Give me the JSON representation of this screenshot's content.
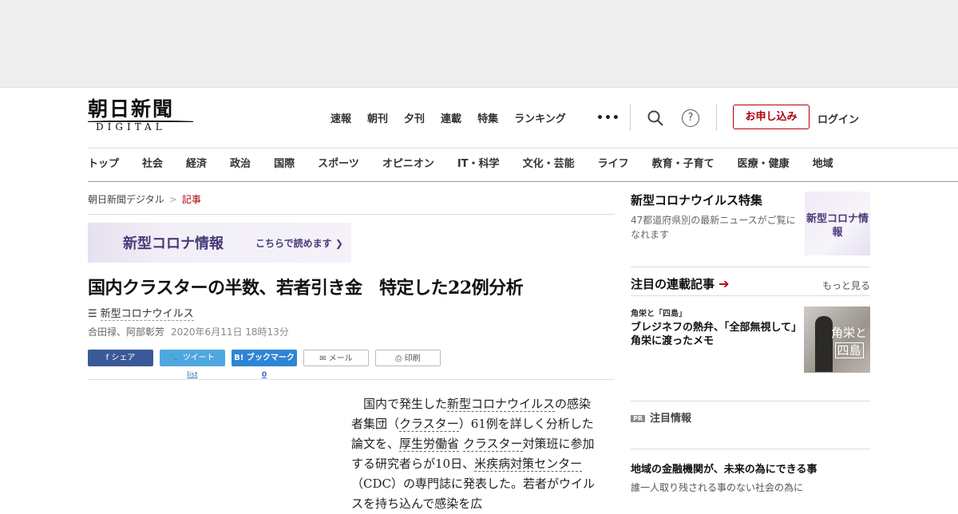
{
  "site": {
    "logo_kanji": "朝日新聞",
    "logo_sub": "DIGITAL",
    "top_nav": [
      "速報",
      "朝刊",
      "夕刊",
      "連載",
      "特集",
      "ランキング"
    ],
    "more": "•••",
    "help": "?",
    "subscribe_label": "お申し込み",
    "login_label": "ログイン",
    "categories": [
      "トップ",
      "社会",
      "経済",
      "政治",
      "国際",
      "スポーツ",
      "オピニオン",
      "IT・科学",
      "文化・芸能",
      "ライフ",
      "教育・子育て",
      "医療・健康",
      "地域"
    ]
  },
  "breadcrumb": {
    "home": "朝日新聞デジタル",
    "separator": ">",
    "current": "記事"
  },
  "banner": {
    "title": "新型コロナ情報",
    "cta": "こちらで読めます ❯"
  },
  "article": {
    "headline": "国内クラスターの半数、若者引き金　特定した22例分析",
    "tag_icon": "☰",
    "tag": "新型コロナウイルス",
    "authors": "合田禄、阿部彰芳",
    "date": "2020年6月11日 18時13分",
    "share": {
      "facebook": "シェア",
      "twitter": "ツイート",
      "twitter_count": "list",
      "hatena": "ブックマーク",
      "hatena_count": "0",
      "mail": "メール",
      "print": "印刷"
    },
    "body": {
      "p1": "国内で発生した",
      "k1": "新型コロナウイルス",
      "p2": "の感染者集団（",
      "k2": "クラスター",
      "p3": "）61例を詳しく分析した論文を、",
      "k3": "厚生労働省",
      "k4": "クラスター",
      "p4": "対策班に参加する研究者らが10日、",
      "k5": "米疾病対策センター",
      "p5": "（CDC）の専門誌に発表した。若者がウイルスを持ち込んで感染を広"
    }
  },
  "sidebar": {
    "feature_title": "新型コロナウイルス特集",
    "feature_desc": "47都道府県別の最新ニュースがご覧になれます",
    "feature_thumb": "新型コロナ情報",
    "rensai_title": "注目の連載記事",
    "rensai_arrow": "➔",
    "rensai_more": "もっと見る",
    "rensai_label": "角栄と「四島」",
    "rensai_headline": "ブレジネフの熱弁、「全部無視して」　角栄に渡ったメモ",
    "rensai_thumb_l1": "角栄と",
    "rensai_thumb_l2": "四島",
    "pr_badge": "PR",
    "pr_title": "注目情報",
    "pr_item_title": "地域の金融機関が、未来の為にできる事",
    "pr_item_desc": "誰一人取り残される事のない社会の為に"
  }
}
